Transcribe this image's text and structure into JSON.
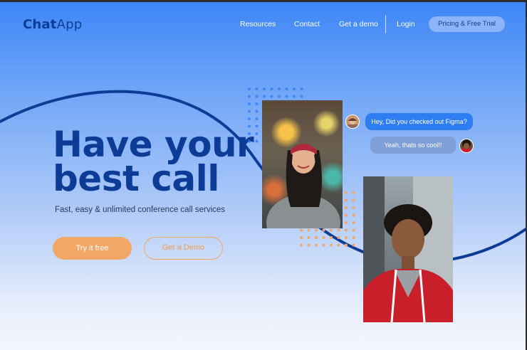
{
  "brand": {
    "name_bold": "Chat",
    "name_light": "App"
  },
  "nav": {
    "links": [
      "Resources",
      "Contact",
      "Get a demo",
      "Login"
    ],
    "cta": "Pricing & Free Trial"
  },
  "hero": {
    "title_line1": "Have your",
    "title_line2": "best call",
    "subtitle": "Fast, easy & unlimited conference call services",
    "primary_cta": "Try it free",
    "secondary_cta": "Get a Demo"
  },
  "chat": {
    "messages": [
      {
        "text": "Hey, Did you checked out Figma?"
      },
      {
        "text": "Yeah, thats so cool!!"
      }
    ]
  },
  "colors": {
    "brand_dark": "#0d3c96",
    "accent_orange": "#f2a766",
    "bubble_blue": "#2f7df3",
    "bubble_muted": "#7f9fd8"
  }
}
